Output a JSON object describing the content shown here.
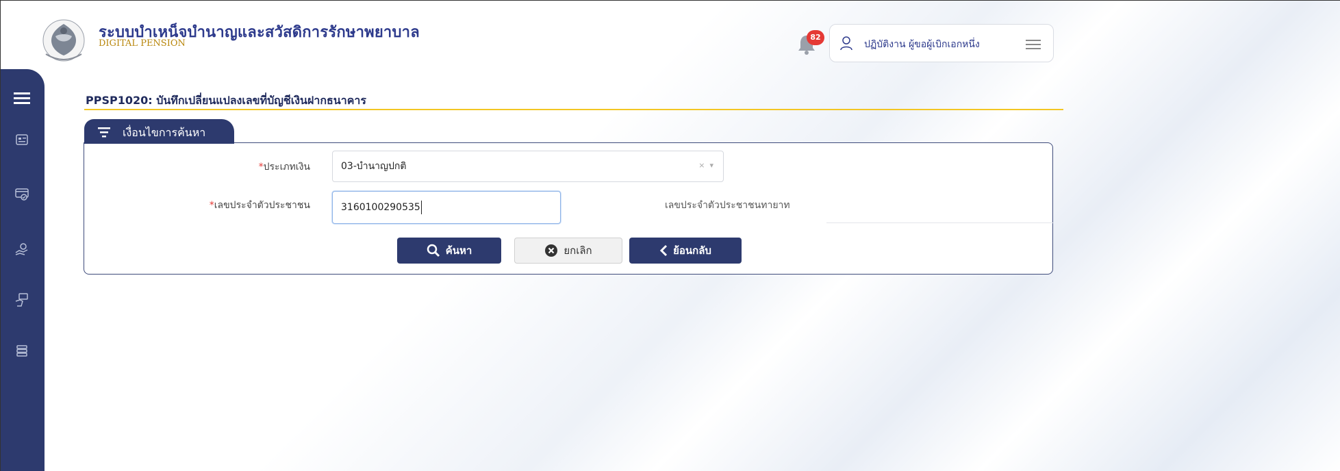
{
  "header": {
    "title": "ระบบบำเหน็จบำนาญและสวัสดิการรักษาพยาบาล",
    "subtitle": "DIGITAL PENSION",
    "notification_count": "82",
    "user": "ปฏิบัติงาน ผู้ขอผู้เบิกเอกหนึ่ง"
  },
  "sidebar": {
    "icons": [
      "list-card-icon",
      "monitor-check-icon",
      "hand-coin-icon",
      "hand-pay-icon",
      "database-icon"
    ]
  },
  "page": {
    "title": "PPSP1020: บันทึกเปลี่ยนแปลงเลขที่บัญชีเงินฝากธนาคาร"
  },
  "search": {
    "section_label": "เงื่อนไขการค้นหา",
    "money_type_label": "ประเภทเงิน",
    "money_type_value": "03-บำนาญปกติ",
    "citizen_id_label": "เลขประจำตัวประชาชน",
    "citizen_id_value": "3160100290535",
    "heir_id_label": "เลขประจำตัวประชาชนทายาท",
    "required_mark": "*"
  },
  "buttons": {
    "search": "ค้นหา",
    "cancel": "ยกเลิก",
    "back": "ย้อนกลับ"
  },
  "colors": {
    "primary": "#2d3a6e",
    "accent_line": "#f3c623",
    "badge": "#e53935",
    "required": "#e53935"
  }
}
